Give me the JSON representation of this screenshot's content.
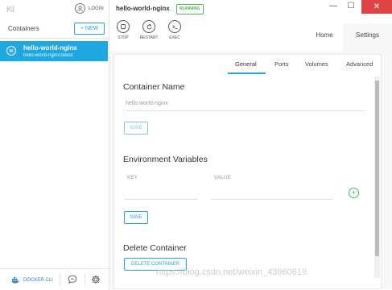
{
  "sidebar": {
    "logo": "KI",
    "login_label": "LOGIN",
    "containers_label": "Containers",
    "new_label": "+ NEW",
    "selected_container": {
      "name": "hello-world-nginx",
      "image": "hello-world-nginx:latest"
    },
    "footer": {
      "docker_cli_label": "DOCKER CLI"
    }
  },
  "header": {
    "container_title": "hello-world-nginx",
    "status": "RUNNING",
    "actions": [
      {
        "label": "STOP"
      },
      {
        "label": "RESTART"
      },
      {
        "label": "EXEC"
      }
    ],
    "tabs": [
      {
        "label": "Home"
      },
      {
        "label": "Settings"
      }
    ],
    "window_controls": {
      "minimize": "—",
      "maximize": "☐",
      "close": "✕"
    }
  },
  "settings": {
    "subtabs": [
      {
        "label": "General"
      },
      {
        "label": "Ports"
      },
      {
        "label": "Volumes"
      },
      {
        "label": "Advanced"
      }
    ],
    "container_name_section": {
      "title": "Container Name",
      "value": "hello-world-nginx",
      "save_label": "SAVE"
    },
    "env_section": {
      "title": "Environment Variables",
      "key_label": "KEY",
      "value_label": "VALUE",
      "save_label": "SAVE"
    },
    "delete_section": {
      "title": "Delete Container",
      "delete_label": "DELETE CONTAINER"
    }
  },
  "watermark": "https://blog.csdn.net/weixin_43960619",
  "colors": {
    "accent": "#1fa8e0",
    "running": "#4cba52",
    "close": "#e04343"
  }
}
